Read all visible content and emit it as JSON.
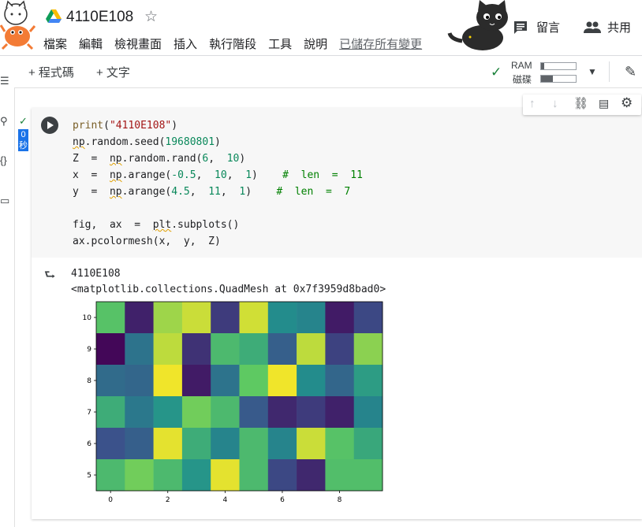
{
  "header": {
    "title": "4110E108",
    "star_icon": "star-outline-icon",
    "menu": [
      "檔案",
      "編輯",
      "檢視畫面",
      "插入",
      "執行階段",
      "工具",
      "說明"
    ],
    "saved_status": "已儲存所有變更",
    "comment_label": "留言",
    "share_label": "共用"
  },
  "toolbar": {
    "add_code": "+ 程式碼",
    "add_text": "+ 文字",
    "ram_label": "RAM",
    "disk_label": "磁碟",
    "ram_usage": 0.08,
    "disk_usage": 0.35
  },
  "cell": {
    "exec_time": "0\n秒",
    "code_lines": [
      "print(\"4110E108\")",
      "np.random.seed(19680801)",
      "Z = np.random.rand(6, 10)",
      "x = np.arange(-0.5, 10, 1)  # len = 11",
      "y = np.arange(4.5, 11, 1)  # len = 7",
      "",
      "fig, ax = plt.subplots()",
      "ax.pcolormesh(x, y, Z)"
    ],
    "output_lines": [
      "4110E108",
      "<matplotlib.collections.QuadMesh at 0x7f3959d8bad0>"
    ]
  },
  "chart_data": {
    "type": "heatmap",
    "x_edges": [
      -0.5,
      0.5,
      1.5,
      2.5,
      3.5,
      4.5,
      5.5,
      6.5,
      7.5,
      8.5,
      9.5
    ],
    "y_edges": [
      4.5,
      5.5,
      6.5,
      7.5,
      8.5,
      9.5,
      10.5
    ],
    "xticks": [
      0,
      2,
      4,
      6,
      8
    ],
    "yticks": [
      5,
      6,
      7,
      8,
      9,
      10
    ],
    "xlim": [
      -0.5,
      9.5
    ],
    "ylim": [
      4.5,
      10.5
    ],
    "colormap": "viridis",
    "rows_top_to_bottom": [
      [
        0.72,
        0.1,
        0.85,
        0.92,
        0.18,
        0.93,
        0.48,
        0.45,
        0.08,
        0.22
      ],
      [
        0.02,
        0.38,
        0.9,
        0.15,
        0.68,
        0.62,
        0.3,
        0.9,
        0.2,
        0.82
      ],
      [
        0.35,
        0.33,
        0.98,
        0.08,
        0.38,
        0.75,
        0.98,
        0.48,
        0.33,
        0.55
      ],
      [
        0.62,
        0.4,
        0.52,
        0.78,
        0.68,
        0.28,
        0.12,
        0.18,
        0.1,
        0.45
      ],
      [
        0.25,
        0.3,
        0.96,
        0.62,
        0.45,
        0.68,
        0.45,
        0.92,
        0.72,
        0.6
      ],
      [
        0.68,
        0.78,
        0.68,
        0.52,
        0.96,
        0.68,
        0.22,
        0.12,
        0.7,
        0.7
      ]
    ]
  }
}
